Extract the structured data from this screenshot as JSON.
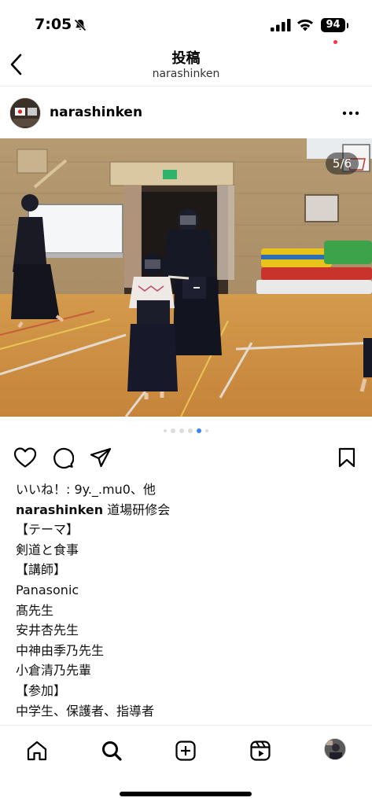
{
  "status_bar": {
    "time": "7:05",
    "battery": "94"
  },
  "nav": {
    "title": "投稿",
    "subtitle": "narashinken"
  },
  "post": {
    "username": "narashinken",
    "image_counter": "5/6",
    "carousel": {
      "total_dots": 6,
      "active_index": 4
    }
  },
  "caption": {
    "likes_line": "いいね！: 9y._.mu0、他",
    "author": "narashinken",
    "first_text": "道場研修会",
    "lines": [
      "【テーマ】",
      "剣道と食事",
      "【講師】",
      "Panasonic",
      "髙先生",
      "安井杏先生",
      "中神由季乃先生",
      "小倉清乃先輩",
      "【参加】",
      "中学生、保護者、指導者"
    ]
  },
  "colors": {
    "accent_dot": "#3b82f6",
    "notification": "#ff3040"
  }
}
